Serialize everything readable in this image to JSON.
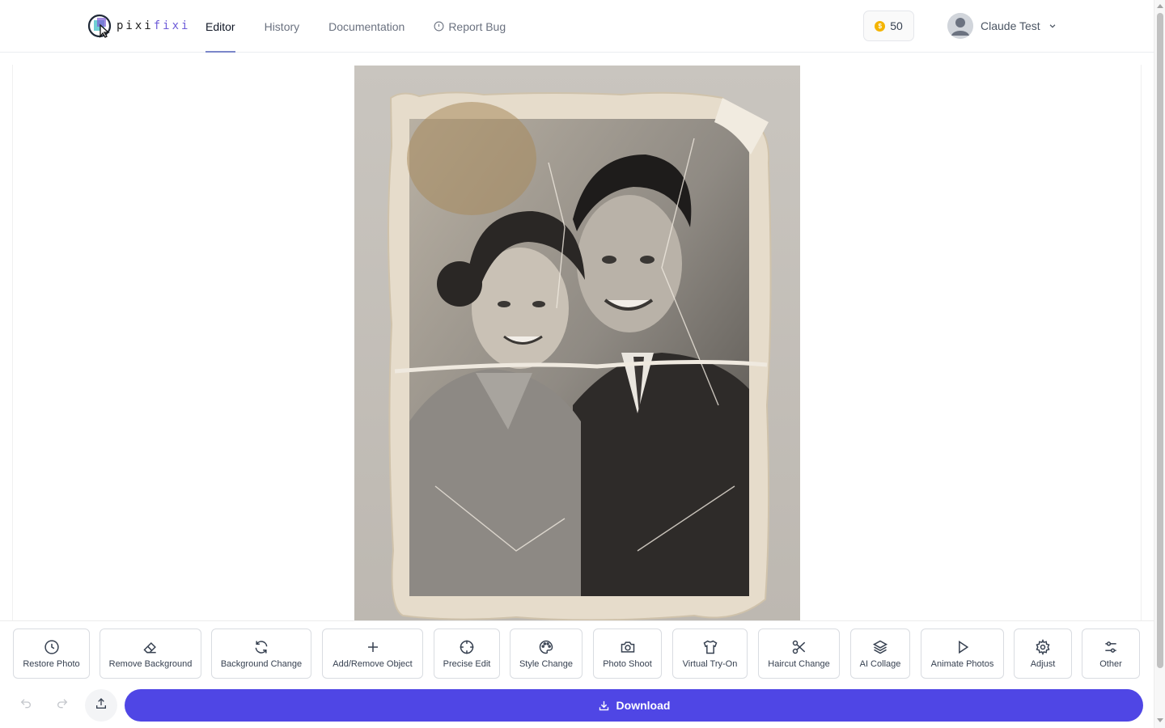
{
  "brand": {
    "name_part1": "pixi",
    "name_part2": "fixi"
  },
  "nav": {
    "items": [
      {
        "label": "Editor",
        "active": true
      },
      {
        "label": "History",
        "active": false
      },
      {
        "label": "Documentation",
        "active": false
      },
      {
        "label": "Report Bug",
        "active": false,
        "icon": "alert-circle-icon"
      }
    ]
  },
  "credits": {
    "value": "50",
    "icon": "coin-icon",
    "color": "#f4b400"
  },
  "user": {
    "name": "Claude Test",
    "icon": "chevron-down-icon"
  },
  "canvas": {
    "image_alt": "Old damaged vintage photo of a smiling couple"
  },
  "tools": [
    {
      "label": "Restore Photo",
      "icon": "clock-icon"
    },
    {
      "label": "Remove Background",
      "icon": "eraser-icon"
    },
    {
      "label": "Background Change",
      "icon": "refresh-icon"
    },
    {
      "label": "Add/Remove Object",
      "icon": "plus-icon"
    },
    {
      "label": "Precise Edit",
      "icon": "crosshair-icon"
    },
    {
      "label": "Style Change",
      "icon": "palette-icon"
    },
    {
      "label": "Photo Shoot",
      "icon": "camera-icon"
    },
    {
      "label": "Virtual Try-On",
      "icon": "shirt-icon"
    },
    {
      "label": "Haircut Change",
      "icon": "scissors-icon"
    },
    {
      "label": "AI Collage",
      "icon": "layers-icon"
    },
    {
      "label": "Animate Photos",
      "icon": "play-icon"
    },
    {
      "label": "Adjust",
      "icon": "gear-icon"
    },
    {
      "label": "Other",
      "icon": "sliders-icon"
    }
  ],
  "actions": {
    "download_label": "Download"
  },
  "colors": {
    "accent": "#4f46e5",
    "active_tab_underline": "#7b86c9"
  }
}
